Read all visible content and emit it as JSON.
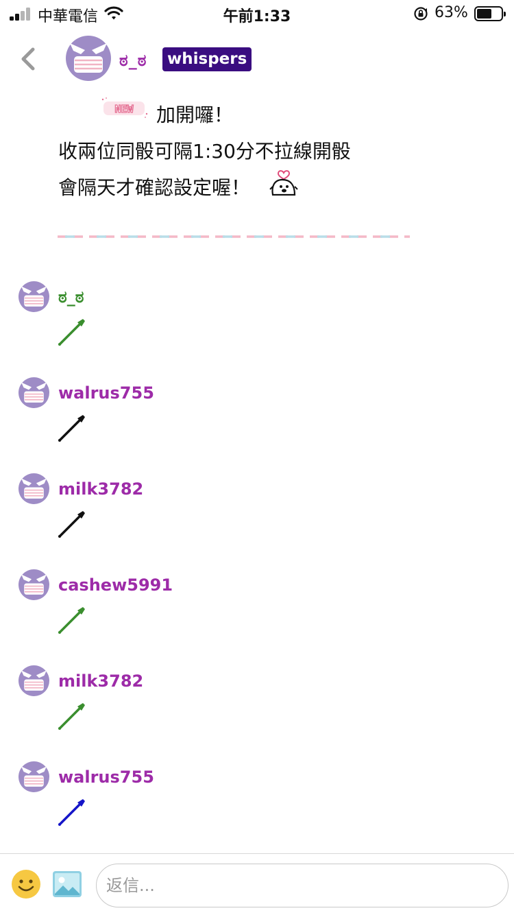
{
  "status_bar": {
    "carrier": "中華電信",
    "time": "午前1:33",
    "battery_percent": "63%",
    "battery_level": 0.63,
    "signal_bars": 2,
    "signal_total": 4
  },
  "header": {
    "back_icon": "chevron-left-icon",
    "op_name": "ಠ_ಠ",
    "badge": "whispers",
    "badge_color": "#3a0d80",
    "name_color": "#9d2ba8"
  },
  "post": {
    "line1": "加開囉！",
    "line2": "收兩位同骰可隔1:30分不拉線開骰",
    "line3": "會隔天才確認設定喔！",
    "new_sticker_text": "NEW"
  },
  "comments": [
    {
      "username": "ಠ_ಠ",
      "username_color": "#3a8e2e",
      "vuvu_color": "#3a8e2e"
    },
    {
      "username": "walrus755",
      "username_color": "#9d2ba8",
      "vuvu_color": "#111111"
    },
    {
      "username": "milk3782",
      "username_color": "#9d2ba8",
      "vuvu_color": "#111111"
    },
    {
      "username": "cashew5991",
      "username_color": "#9d2ba8",
      "vuvu_color": "#3a8e2e"
    },
    {
      "username": "milk3782",
      "username_color": "#9d2ba8",
      "vuvu_color": "#3a8e2e"
    },
    {
      "username": "walrus755",
      "username_color": "#9d2ba8",
      "vuvu_color": "#1515c8"
    }
  ],
  "reply": {
    "placeholder": "返信...",
    "emoji_icon": "smiley-icon",
    "image_icon": "image-icon"
  }
}
